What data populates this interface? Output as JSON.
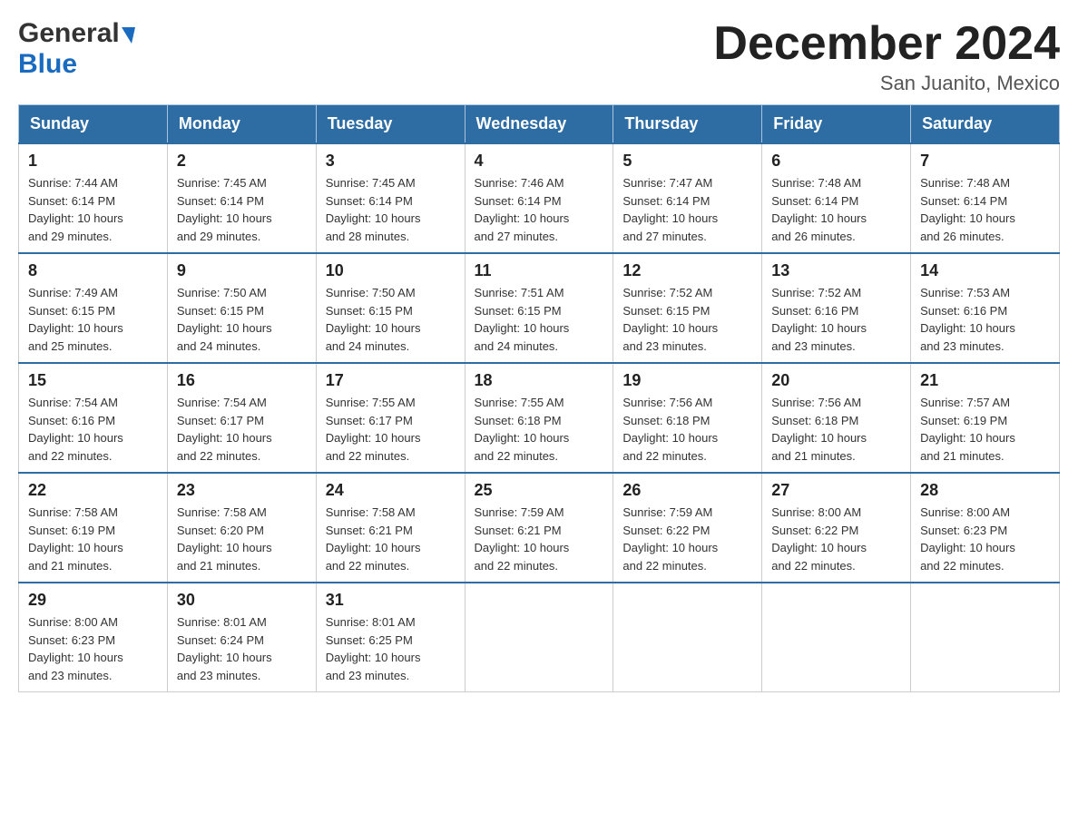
{
  "header": {
    "logo_general": "General",
    "logo_blue": "Blue",
    "month_title": "December 2024",
    "location": "San Juanito, Mexico"
  },
  "calendar": {
    "days_of_week": [
      "Sunday",
      "Monday",
      "Tuesday",
      "Wednesday",
      "Thursday",
      "Friday",
      "Saturday"
    ],
    "weeks": [
      [
        {
          "day": "1",
          "sunrise": "7:44 AM",
          "sunset": "6:14 PM",
          "daylight": "10 hours and 29 minutes."
        },
        {
          "day": "2",
          "sunrise": "7:45 AM",
          "sunset": "6:14 PM",
          "daylight": "10 hours and 29 minutes."
        },
        {
          "day": "3",
          "sunrise": "7:45 AM",
          "sunset": "6:14 PM",
          "daylight": "10 hours and 28 minutes."
        },
        {
          "day": "4",
          "sunrise": "7:46 AM",
          "sunset": "6:14 PM",
          "daylight": "10 hours and 27 minutes."
        },
        {
          "day": "5",
          "sunrise": "7:47 AM",
          "sunset": "6:14 PM",
          "daylight": "10 hours and 27 minutes."
        },
        {
          "day": "6",
          "sunrise": "7:48 AM",
          "sunset": "6:14 PM",
          "daylight": "10 hours and 26 minutes."
        },
        {
          "day": "7",
          "sunrise": "7:48 AM",
          "sunset": "6:14 PM",
          "daylight": "10 hours and 26 minutes."
        }
      ],
      [
        {
          "day": "8",
          "sunrise": "7:49 AM",
          "sunset": "6:15 PM",
          "daylight": "10 hours and 25 minutes."
        },
        {
          "day": "9",
          "sunrise": "7:50 AM",
          "sunset": "6:15 PM",
          "daylight": "10 hours and 24 minutes."
        },
        {
          "day": "10",
          "sunrise": "7:50 AM",
          "sunset": "6:15 PM",
          "daylight": "10 hours and 24 minutes."
        },
        {
          "day": "11",
          "sunrise": "7:51 AM",
          "sunset": "6:15 PM",
          "daylight": "10 hours and 24 minutes."
        },
        {
          "day": "12",
          "sunrise": "7:52 AM",
          "sunset": "6:15 PM",
          "daylight": "10 hours and 23 minutes."
        },
        {
          "day": "13",
          "sunrise": "7:52 AM",
          "sunset": "6:16 PM",
          "daylight": "10 hours and 23 minutes."
        },
        {
          "day": "14",
          "sunrise": "7:53 AM",
          "sunset": "6:16 PM",
          "daylight": "10 hours and 23 minutes."
        }
      ],
      [
        {
          "day": "15",
          "sunrise": "7:54 AM",
          "sunset": "6:16 PM",
          "daylight": "10 hours and 22 minutes."
        },
        {
          "day": "16",
          "sunrise": "7:54 AM",
          "sunset": "6:17 PM",
          "daylight": "10 hours and 22 minutes."
        },
        {
          "day": "17",
          "sunrise": "7:55 AM",
          "sunset": "6:17 PM",
          "daylight": "10 hours and 22 minutes."
        },
        {
          "day": "18",
          "sunrise": "7:55 AM",
          "sunset": "6:18 PM",
          "daylight": "10 hours and 22 minutes."
        },
        {
          "day": "19",
          "sunrise": "7:56 AM",
          "sunset": "6:18 PM",
          "daylight": "10 hours and 22 minutes."
        },
        {
          "day": "20",
          "sunrise": "7:56 AM",
          "sunset": "6:18 PM",
          "daylight": "10 hours and 21 minutes."
        },
        {
          "day": "21",
          "sunrise": "7:57 AM",
          "sunset": "6:19 PM",
          "daylight": "10 hours and 21 minutes."
        }
      ],
      [
        {
          "day": "22",
          "sunrise": "7:58 AM",
          "sunset": "6:19 PM",
          "daylight": "10 hours and 21 minutes."
        },
        {
          "day": "23",
          "sunrise": "7:58 AM",
          "sunset": "6:20 PM",
          "daylight": "10 hours and 21 minutes."
        },
        {
          "day": "24",
          "sunrise": "7:58 AM",
          "sunset": "6:21 PM",
          "daylight": "10 hours and 22 minutes."
        },
        {
          "day": "25",
          "sunrise": "7:59 AM",
          "sunset": "6:21 PM",
          "daylight": "10 hours and 22 minutes."
        },
        {
          "day": "26",
          "sunrise": "7:59 AM",
          "sunset": "6:22 PM",
          "daylight": "10 hours and 22 minutes."
        },
        {
          "day": "27",
          "sunrise": "8:00 AM",
          "sunset": "6:22 PM",
          "daylight": "10 hours and 22 minutes."
        },
        {
          "day": "28",
          "sunrise": "8:00 AM",
          "sunset": "6:23 PM",
          "daylight": "10 hours and 22 minutes."
        }
      ],
      [
        {
          "day": "29",
          "sunrise": "8:00 AM",
          "sunset": "6:23 PM",
          "daylight": "10 hours and 23 minutes."
        },
        {
          "day": "30",
          "sunrise": "8:01 AM",
          "sunset": "6:24 PM",
          "daylight": "10 hours and 23 minutes."
        },
        {
          "day": "31",
          "sunrise": "8:01 AM",
          "sunset": "6:25 PM",
          "daylight": "10 hours and 23 minutes."
        },
        null,
        null,
        null,
        null
      ]
    ],
    "labels": {
      "sunrise": "Sunrise:",
      "sunset": "Sunset:",
      "daylight": "Daylight:"
    }
  }
}
